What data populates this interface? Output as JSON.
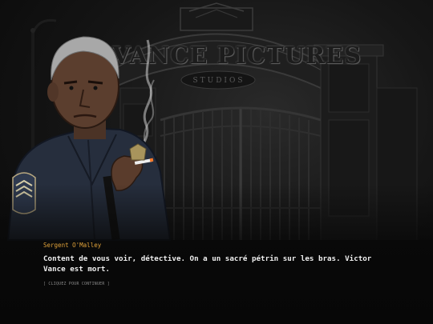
{
  "scene": {
    "sign": {
      "title": "VANCE PICTURES",
      "subtitle": "STUDIOS"
    }
  },
  "dialogue": {
    "speaker": "Sergent O'Malley",
    "text": "Content de vous voir, détective. On a un sacré pétrin sur les bras. Victor Vance est mort.",
    "continue_hint": "[ CLIQUEZ POUR CONTINUER ]"
  },
  "colors": {
    "speaker_name": "#e0a23a",
    "dialogue_text": "#efefef",
    "hint_text": "#8c8c8c",
    "background": "#0b0b0b"
  },
  "icons": {
    "character": "police-sergeant-portrait",
    "badge": "lapd-shoulder-patch",
    "cigarette": "cigarette-smoke"
  }
}
